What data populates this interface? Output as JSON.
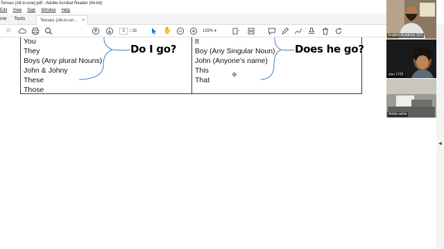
{
  "window": {
    "title": "Tenses (All-in-one).pdf - Adobe Acrobat Reader (64-bit)"
  },
  "menu": [
    "Edit",
    "View",
    "Sign",
    "Window",
    "Help"
  ],
  "tabs": {
    "home": "me",
    "tools": "Tools",
    "document": "Tenses (All-in-on...",
    "close": "×"
  },
  "toolbar": {
    "page_current": "3",
    "page_total": "/ 28",
    "zoom": "159%"
  },
  "document": {
    "left_column": [
      "You",
      "They",
      "Boys (Any plural Nouns)",
      "John & Johny",
      "These",
      "Those"
    ],
    "left_phrase": "Do I go?",
    "right_column": [
      "It",
      "Boy (Any Singular Noun)",
      "John (Anyone’s name)",
      "This",
      "That"
    ],
    "right_phrase": "Does he go?"
  },
  "video": {
    "participants": [
      {
        "name": "English Academy 11/1",
        "color": "#7b6a55"
      },
      {
        "name": "",
        "color": "#1d1d1d"
      },
      {
        "name": "vivo 1723",
        "color": "#2a2a2a"
      },
      {
        "name": "Amita sahai",
        "color": "#8a8d86"
      }
    ]
  },
  "colors": {
    "brace": "#3a7fc1",
    "table_border": "#333333",
    "toolbar_accent": "#1473e6"
  }
}
